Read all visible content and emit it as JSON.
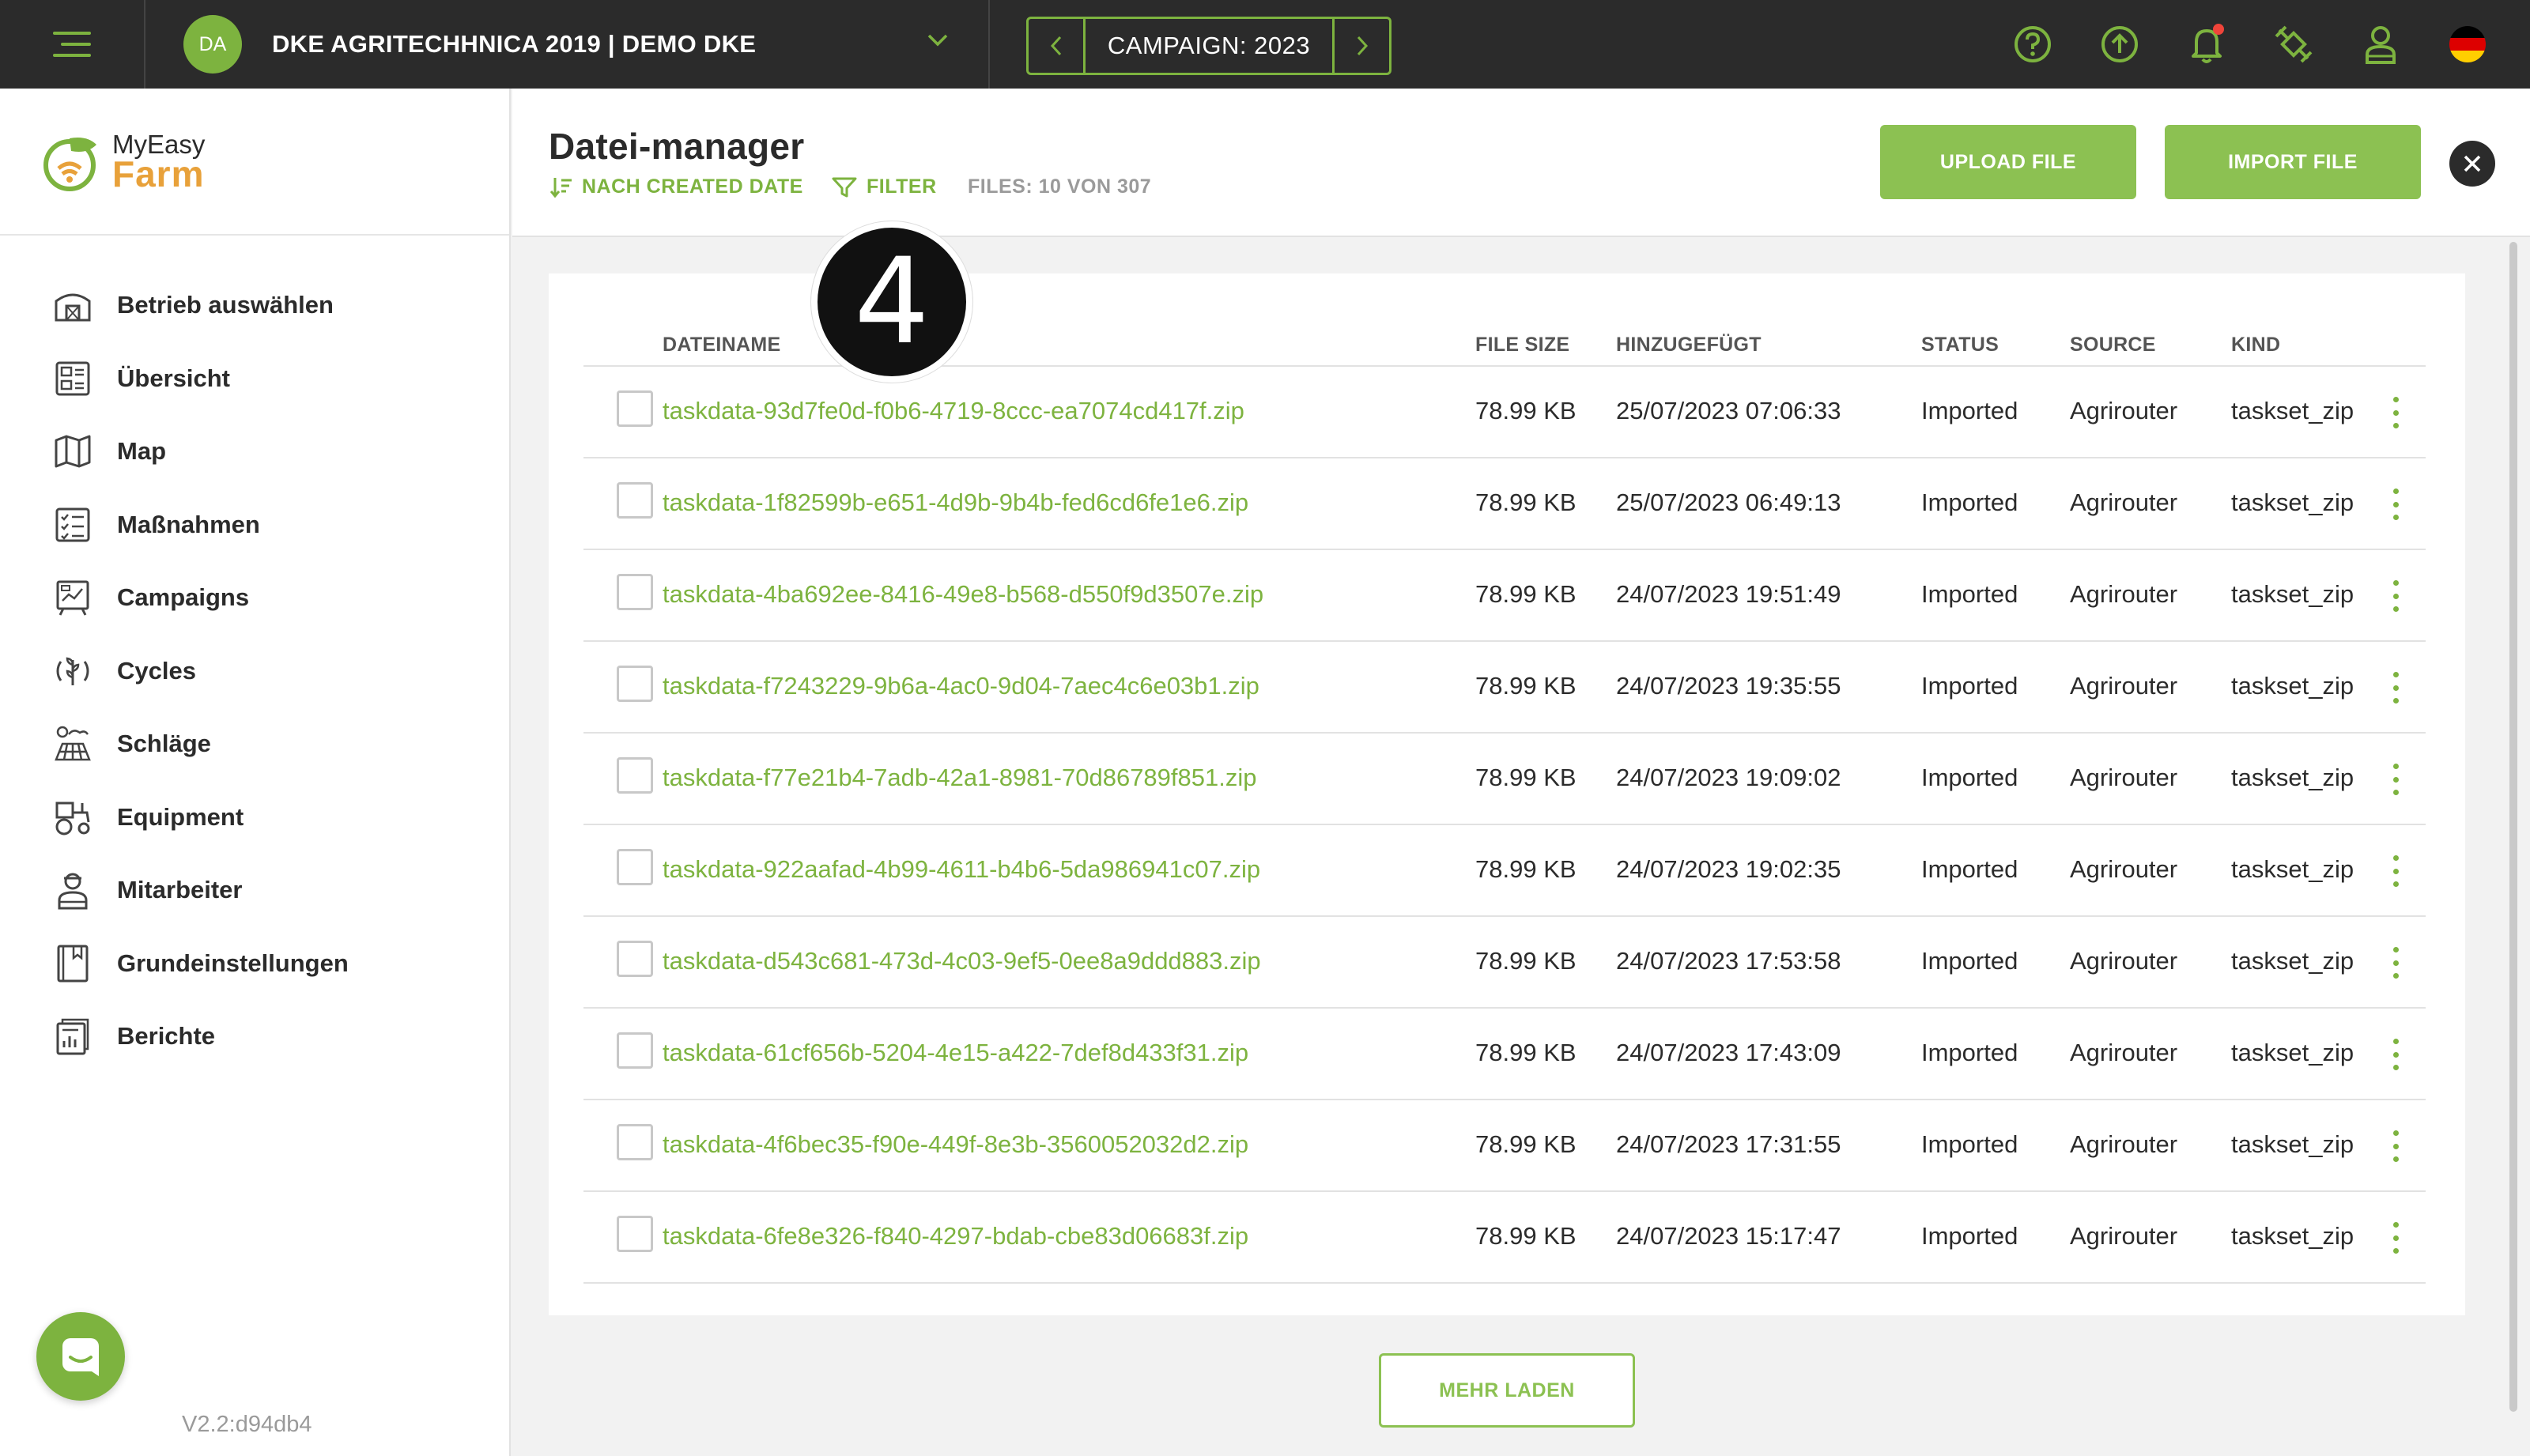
{
  "topbar": {
    "avatar_initials": "DA",
    "farm_name": "DKE AGRITECHHNICA 2019 | DEMO DKE",
    "campaign_label": "CAMPAIGN: 2023",
    "icons": [
      "menu-icon",
      "help-icon",
      "upload-icon",
      "bell-icon",
      "satellite-icon",
      "user-support-icon",
      "german-flag-icon"
    ],
    "notification_dot_color": "#f0443a"
  },
  "sidebar": {
    "logo": {
      "line1": "MyEasy",
      "line2": "Farm"
    },
    "items": [
      {
        "label": "Betrieb auswählen",
        "icon": "farm-building-icon"
      },
      {
        "label": "Übersicht",
        "icon": "dashboard-icon"
      },
      {
        "label": "Map",
        "icon": "map-icon"
      },
      {
        "label": "Maßnahmen",
        "icon": "checklist-icon"
      },
      {
        "label": "Campaigns",
        "icon": "campaign-board-icon"
      },
      {
        "label": "Cycles",
        "icon": "crop-cycle-icon"
      },
      {
        "label": "Schläge",
        "icon": "field-plot-icon"
      },
      {
        "label": "Equipment",
        "icon": "tractor-icon"
      },
      {
        "label": "Mitarbeiter",
        "icon": "worker-icon"
      },
      {
        "label": "Grundeinstellungen",
        "icon": "settings-book-icon"
      },
      {
        "label": "Berichte",
        "icon": "report-icon"
      }
    ],
    "version": "V2.2:d94db4"
  },
  "header": {
    "title": "Datei-manager",
    "sort_label": "NACH CREATED DATE",
    "filter_label": "FILTER",
    "files_count": "FILES: 10 VON 307",
    "upload_label": "UPLOAD FILE",
    "import_label": "IMPORT FILE"
  },
  "table": {
    "columns": {
      "name": "DATEINAME",
      "size": "FILE SIZE",
      "added": "HINZUGEFÜGT",
      "status": "STATUS",
      "source": "SOURCE",
      "kind": "KIND"
    },
    "rows": [
      {
        "name": "taskdata-93d7fe0d-f0b6-4719-8ccc-ea7074cd417f.zip",
        "size": "78.99 KB",
        "added": "25/07/2023 07:06:33",
        "status": "Imported",
        "source": "Agrirouter",
        "kind": "taskset_zip"
      },
      {
        "name": "taskdata-1f82599b-e651-4d9b-9b4b-fed6cd6fe1e6.zip",
        "size": "78.99 KB",
        "added": "25/07/2023 06:49:13",
        "status": "Imported",
        "source": "Agrirouter",
        "kind": "taskset_zip"
      },
      {
        "name": "taskdata-4ba692ee-8416-49e8-b568-d550f9d3507e.zip",
        "size": "78.99 KB",
        "added": "24/07/2023 19:51:49",
        "status": "Imported",
        "source": "Agrirouter",
        "kind": "taskset_zip"
      },
      {
        "name": "taskdata-f7243229-9b6a-4ac0-9d04-7aec4c6e03b1.zip",
        "size": "78.99 KB",
        "added": "24/07/2023 19:35:55",
        "status": "Imported",
        "source": "Agrirouter",
        "kind": "taskset_zip"
      },
      {
        "name": "taskdata-f77e21b4-7adb-42a1-8981-70d86789f851.zip",
        "size": "78.99 KB",
        "added": "24/07/2023 19:09:02",
        "status": "Imported",
        "source": "Agrirouter",
        "kind": "taskset_zip"
      },
      {
        "name": "taskdata-922aafad-4b99-4611-b4b6-5da986941c07.zip",
        "size": "78.99 KB",
        "added": "24/07/2023 19:02:35",
        "status": "Imported",
        "source": "Agrirouter",
        "kind": "taskset_zip"
      },
      {
        "name": "taskdata-d543c681-473d-4c03-9ef5-0ee8a9ddd883.zip",
        "size": "78.99 KB",
        "added": "24/07/2023 17:53:58",
        "status": "Imported",
        "source": "Agrirouter",
        "kind": "taskset_zip"
      },
      {
        "name": "taskdata-61cf656b-5204-4e15-a422-7def8d433f31.zip",
        "size": "78.99 KB",
        "added": "24/07/2023 17:43:09",
        "status": "Imported",
        "source": "Agrirouter",
        "kind": "taskset_zip"
      },
      {
        "name": "taskdata-4f6bec35-f90e-449f-8e3b-3560052032d2.zip",
        "size": "78.99 KB",
        "added": "24/07/2023 17:31:55",
        "status": "Imported",
        "source": "Agrirouter",
        "kind": "taskset_zip"
      },
      {
        "name": "taskdata-6fe8e326-f840-4297-bdab-cbe83d06683f.zip",
        "size": "78.99 KB",
        "added": "24/07/2023 15:17:47",
        "status": "Imported",
        "source": "Agrirouter",
        "kind": "taskset_zip"
      }
    ]
  },
  "load_more_label": "MEHR LADEN",
  "step_badge": "4",
  "colors": {
    "accent": "#8cc152",
    "accent_dark": "#7db33f",
    "topbar": "#2b2b2b",
    "logo_orange": "#e8a13a"
  }
}
